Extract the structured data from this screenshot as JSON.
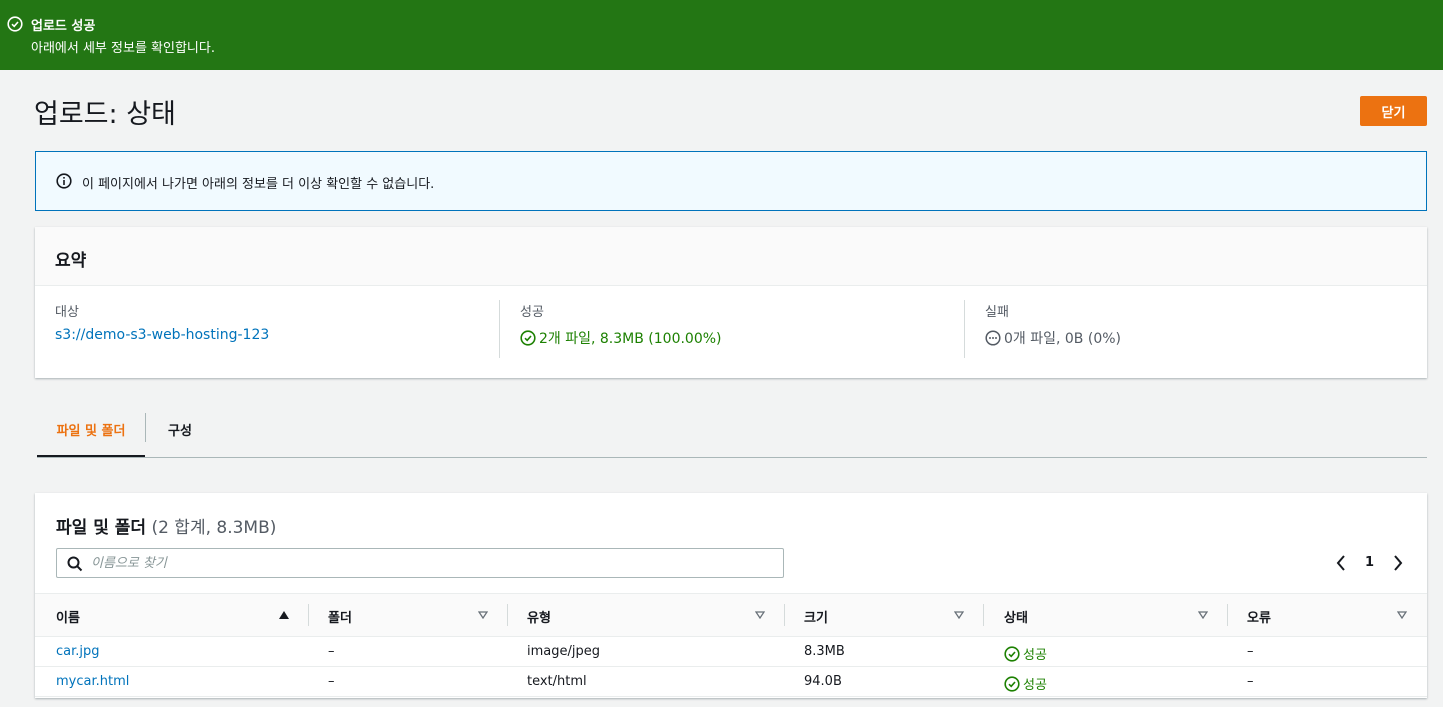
{
  "flash": {
    "title": "업로드 성공",
    "message": "아래에서 세부 정보를 확인합니다."
  },
  "header": {
    "title": "업로드: 상태",
    "close_label": "닫기"
  },
  "info": {
    "text": "이 페이지에서 나가면 아래의 정보를 더 이상 확인할 수 없습니다."
  },
  "summary": {
    "title": "요약",
    "destination_label": "대상",
    "destination_value": "s3://demo-s3-web-hosting-123",
    "success_label": "성공",
    "success_value": "2개 파일, 8.3MB (100.00%)",
    "failure_label": "실패",
    "failure_value": "0개 파일, 0B (0%)"
  },
  "tabs": [
    {
      "label": "파일 및 폴더"
    },
    {
      "label": "구성"
    }
  ],
  "files": {
    "title": "파일 및 폴더",
    "count": "(2 합계, 8.3MB)",
    "search_placeholder": "이름으로 찾기",
    "page": "1",
    "columns": [
      "이름",
      "폴더",
      "유형",
      "크기",
      "상태",
      "오류"
    ],
    "rows": [
      {
        "name": "car.jpg",
        "folder": "–",
        "type": "image/jpeg",
        "size": "8.3MB",
        "status": "성공",
        "error": "–"
      },
      {
        "name": "mycar.html",
        "folder": "–",
        "type": "text/html",
        "size": "94.0B",
        "status": "성공",
        "error": "–"
      }
    ]
  },
  "colors": {
    "success": "#1d8102",
    "flash_bg": "#237614",
    "accent": "#ec7211",
    "link": "#0073bb"
  },
  "icons": [
    "check-circle-icon",
    "info-icon",
    "ellipsis-circle-icon",
    "search-icon",
    "chevron-left-icon",
    "chevron-right-icon",
    "sort-ascending-icon",
    "sort-icon"
  ]
}
